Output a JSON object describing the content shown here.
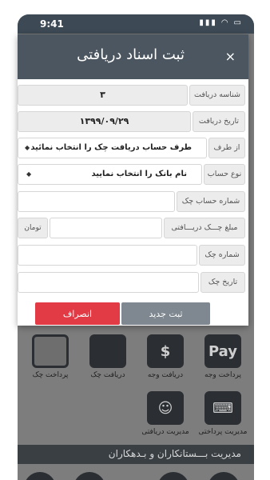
{
  "status": {
    "time": "9:41",
    "icons": "▮▮▮ ◠ ▭"
  },
  "modal": {
    "title": "ثبت اسناد دریافتی",
    "close_icon": "×",
    "fields": {
      "receipt_id": {
        "label": "شناسه دریافت",
        "value": "۳"
      },
      "receipt_date": {
        "label": "تاریخ دریافت",
        "value": "۱۳۹۹/۰۹/۲۹"
      },
      "from_party": {
        "label": "از طرف",
        "value": "طرف حساب دریافت چک را انتخاب نمائید"
      },
      "account_type": {
        "label": "نوع حساب",
        "value": "نام بانک را انتخاب نمایید"
      },
      "account_number": {
        "label": "شماره حساب چک",
        "value": ""
      },
      "cheque_amount": {
        "label": "مبلغ چـــک دریـــافتی",
        "value": "",
        "unit": "تومان"
      },
      "cheque_number": {
        "label": "شماره چک",
        "value": ""
      },
      "cheque_date": {
        "label": "تاریخ چک",
        "value": ""
      }
    },
    "buttons": {
      "new": "ثبت جدید",
      "cancel": "انصراف"
    }
  },
  "background": {
    "row1": [
      {
        "label": "پرداخت وجه",
        "icon": "Pay"
      },
      {
        "label": "دریافت وجه",
        "icon": "$"
      },
      {
        "label": "دریافت چک",
        "icon": ""
      },
      {
        "label": "پرداخت چک",
        "icon": ""
      }
    ],
    "row2": [
      {
        "label": "مدیریت پرداختی",
        "icon": "⌨"
      },
      {
        "label": "مدیریت دریافتی",
        "icon": "☺"
      }
    ],
    "section_title": "مدیریت بـــستانکاران و بـدهکاران"
  },
  "colors": {
    "header": "#4b5660",
    "cancel": "#e23b46",
    "new": "#7f8890"
  }
}
